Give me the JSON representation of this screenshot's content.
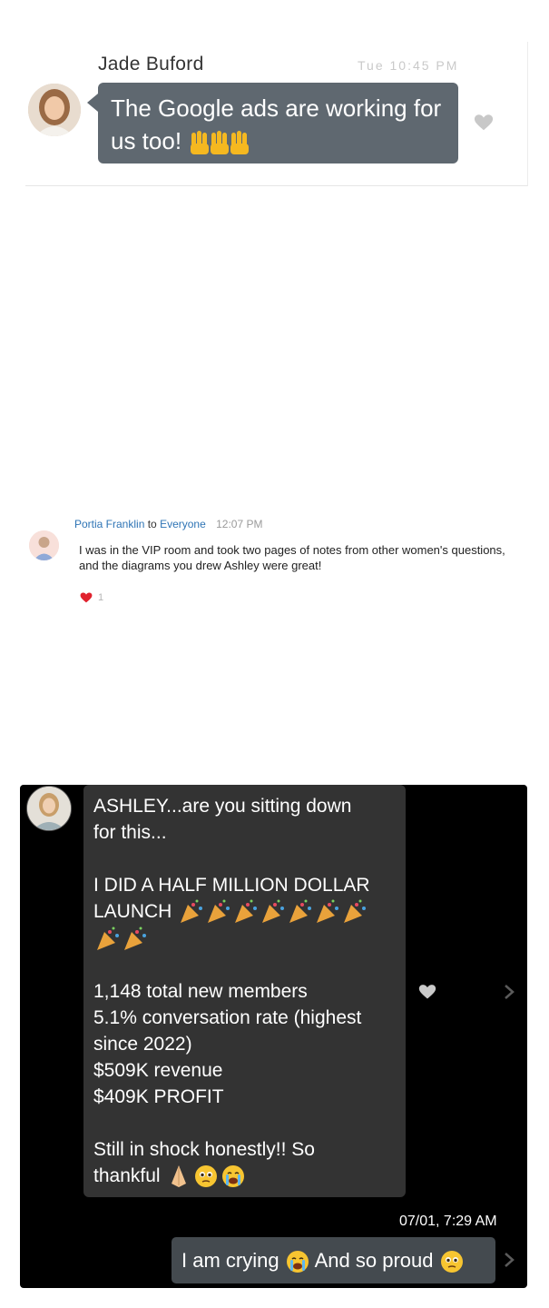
{
  "panel_top": {
    "sender": "Jade Buford",
    "timestamp": "Tue 10:45 PM",
    "message": "The Google ads are working for us too!",
    "message_emoji": "raised-hands-emoji"
  },
  "panel_middle": {
    "sender": "Portia Franklin",
    "to_word": "to",
    "recipient": "Everyone",
    "time": "12:07 PM",
    "message": "I was in the VIP room and took two pages of notes from other women's questions, and the diagrams you drew Ashley were great!",
    "reaction_count": "1",
    "reaction_color": "#e0222e"
  },
  "panel_bottom": {
    "incoming_lines": [
      "ASHLEY...are you sitting down",
      "for this...",
      "",
      "I DID A HALF MILLION DOLLAR",
      "LAUNCH",
      "",
      "",
      "1,148 total new members",
      "5.1% conversation rate (highest",
      "since 2022)",
      "$509K revenue",
      "$409K PROFIT",
      "",
      "Still in shock honestly!! So",
      "thankful"
    ],
    "timestamp": "07/01, 7:29 AM",
    "outgoing_part1": "I am crying",
    "outgoing_part2": "And so proud",
    "background": "#000000",
    "incoming_bubble_color": "#333333",
    "outgoing_bubble_color": "#444a4f"
  }
}
